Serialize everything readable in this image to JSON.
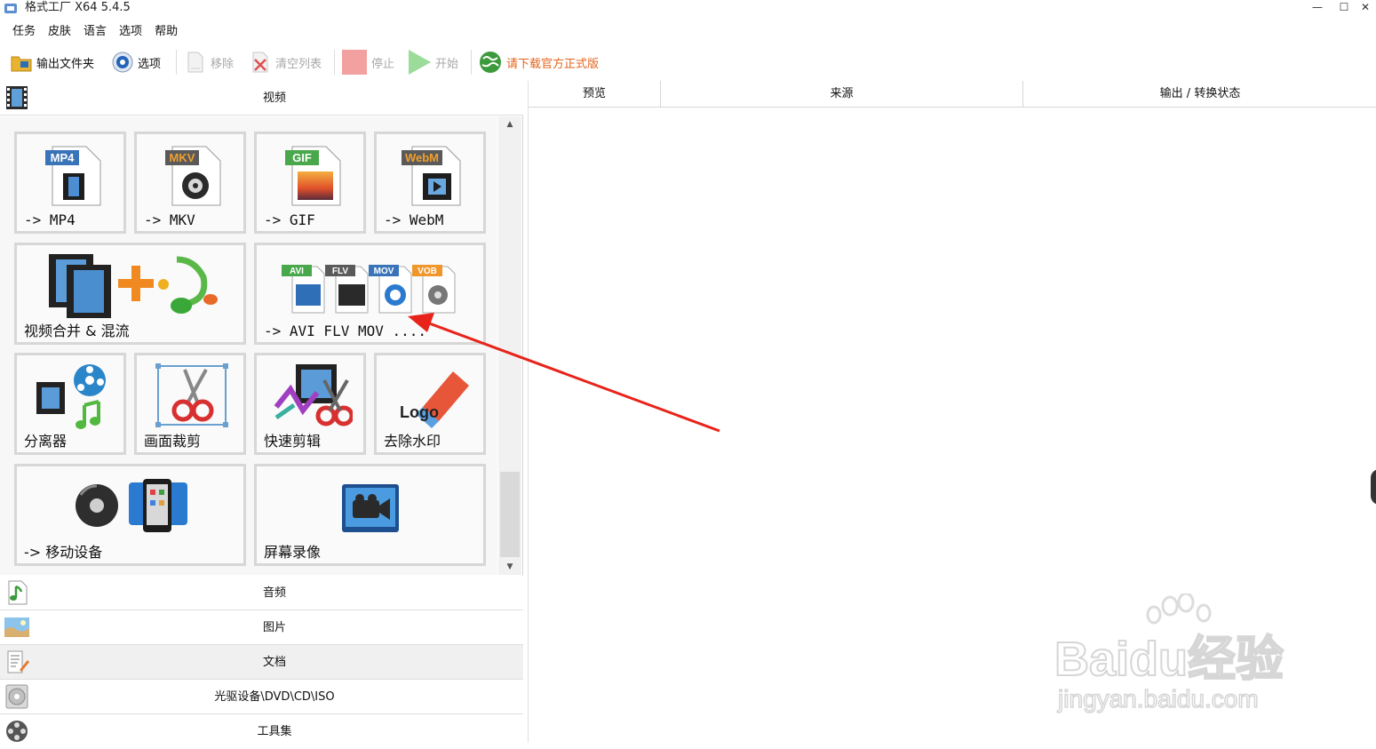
{
  "window": {
    "title": "格式工厂 X64 5.4.5",
    "minimize_glyph": "—",
    "maximize_glyph": "☐",
    "close_glyph": "✕"
  },
  "menu": [
    "任务",
    "皮肤",
    "语言",
    "选项",
    "帮助"
  ],
  "toolbar": {
    "output_folder": "输出文件夹",
    "options": "选项",
    "remove": "移除",
    "clear_list": "清空列表",
    "stop": "停止",
    "start": "开始",
    "download_official": "请下载官方正式版"
  },
  "categories": {
    "video": "视频",
    "audio": "音频",
    "picture": "图片",
    "document": "文档",
    "disc": "光驱设备\\DVD\\CD\\ISO",
    "tools": "工具集"
  },
  "tiles": {
    "mp4": {
      "badge": "MP4",
      "label": "-> MP4"
    },
    "mkv": {
      "badge": "MKV",
      "label": "-> MKV"
    },
    "gif": {
      "badge": "GIF",
      "label": "-> GIF"
    },
    "webm": {
      "badge": "WebM",
      "label": "-> WebM"
    },
    "merge": {
      "label": "视频合并 & 混流"
    },
    "multi": {
      "badges": [
        "AVI",
        "FLV",
        "MOV",
        "VOB"
      ],
      "label": "-> AVI FLV MOV ...."
    },
    "splitter": {
      "label": "分离器"
    },
    "crop": {
      "label": "画面裁剪"
    },
    "quick_clip": {
      "label": "快速剪辑"
    },
    "remove_logo": {
      "label": "去除水印",
      "icon_text": "Logo"
    },
    "mobile": {
      "label": "-> 移动设备"
    },
    "screen_record": {
      "label": "屏幕录像"
    }
  },
  "task_list": {
    "columns": [
      "预览",
      "来源",
      "输出 / 转换状态"
    ]
  },
  "watermark": {
    "brand": "Baidu经验",
    "url": "jingyan.baidu.com"
  },
  "colors": {
    "mp4_badge": "#3a74b8",
    "mkv_badge": "#5a5a5a",
    "gif_badge": "#4aa84c",
    "webm_badge": "#5a5a5a",
    "webm_text": "#f0a030",
    "arrow": "#e8231a",
    "download_text": "#e3641e"
  }
}
